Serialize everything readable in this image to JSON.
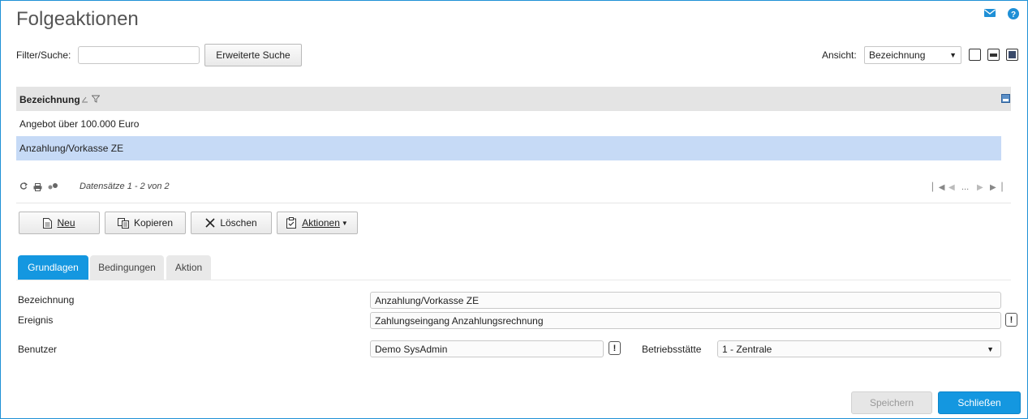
{
  "title": "Folgeaktionen",
  "filter": {
    "label": "Filter/Suche:",
    "value": "",
    "advanced_search_label": "Erweiterte Suche"
  },
  "view": {
    "label": "Ansicht:",
    "selected": "Bezeichnung"
  },
  "grid": {
    "column_header": "Bezeichnung",
    "rows": [
      "Angebot über 100.000 Euro",
      "Anzahlung/Vorkasse ZE"
    ],
    "selected_row": 1,
    "record_info": "Datensätze 1 - 2 von 2",
    "pager_ellipsis": "..."
  },
  "toolbar": {
    "new_label": "Neu",
    "copy_label": "Kopieren",
    "delete_label": "Löschen",
    "actions_label": "Aktionen"
  },
  "tabs": [
    {
      "label": "Grundlagen",
      "active": true
    },
    {
      "label": "Bedingungen",
      "active": false
    },
    {
      "label": "Aktion",
      "active": false
    }
  ],
  "form": {
    "bezeichnung_label": "Bezeichnung",
    "bezeichnung_value": "Anzahlung/Vorkasse ZE",
    "ereignis_label": "Ereignis",
    "ereignis_value": "Zahlungseingang Anzahlungsrechnung",
    "benutzer_label": "Benutzer",
    "benutzer_value": "Demo SysAdmin",
    "betriebsstaette_label": "Betriebsstätte",
    "betriebsstaette_value": "1 - Zentrale",
    "info_mark": "!"
  },
  "footer": {
    "save_label": "Speichern",
    "close_label": "Schließen"
  },
  "colors": {
    "accent": "#1497e0",
    "selected_row": "#c6daf6",
    "header_bg": "#e4e4e4"
  },
  "icons": [
    "mail-icon",
    "help-icon",
    "sort-icon",
    "filter-icon",
    "export-icon",
    "refresh-icon",
    "print-icon",
    "settings-icon",
    "first-page-icon",
    "prev-page-icon",
    "next-page-icon",
    "last-page-icon",
    "new-document-icon",
    "copy-icon",
    "delete-icon",
    "actions-icon"
  ]
}
